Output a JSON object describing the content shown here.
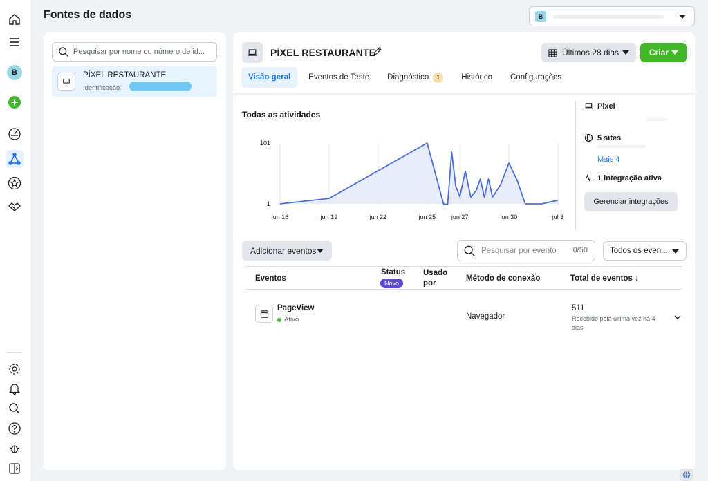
{
  "page": {
    "title": "Fontes de dados"
  },
  "account": {
    "badge": "B"
  },
  "left_rail": {
    "avatar": "B",
    "icons": [
      "home-icon",
      "menu-icon",
      "avatar",
      "add-icon",
      "dashboard-gauge-icon",
      "data-sources-icon",
      "star-icon",
      "partnerships-icon",
      "settings-icon",
      "bell-icon",
      "search-icon",
      "help-icon",
      "bug-icon",
      "panel-toggle-icon"
    ]
  },
  "sources": {
    "search_placeholder": "Pesquisar por nome ou número de id...",
    "items": [
      {
        "name": "PÍXEL RESTAURANTE",
        "id_label": "Identificação"
      }
    ]
  },
  "main": {
    "title": "PÍXEL RESTAURANTE",
    "date_range": "Últimos 28 dias",
    "create_label": "Criar",
    "tabs": [
      {
        "label": "Visão geral",
        "active": true
      },
      {
        "label": "Eventos de Teste"
      },
      {
        "label": "Diagnóstico",
        "badge": "1"
      },
      {
        "label": "Histórico"
      },
      {
        "label": "Configurações"
      }
    ]
  },
  "chart_data": {
    "type": "area",
    "title": "Todas as atividades",
    "x_tick_labels": [
      "jun 16",
      "jun 19",
      "jun 22",
      "jun 25",
      "jun 27",
      "jun 30",
      "jul 3"
    ],
    "y_tick_labels": [
      "1",
      "101"
    ],
    "ylim": [
      1,
      101
    ],
    "x": [
      "jun 16",
      "jun 19",
      "jun 25",
      "jun 26",
      "jun 26",
      "jun 26",
      "jun 26",
      "jun 27",
      "jun 27",
      "jun 27",
      "jun 28",
      "jun 28",
      "jun 28",
      "jun 28",
      "jun 29",
      "jun 29",
      "jun 30",
      "jun 30",
      "jul 1",
      "jul 2",
      "jul 3"
    ],
    "values": [
      1,
      10,
      101,
      1,
      0,
      86,
      30,
      13,
      55,
      12,
      23,
      42,
      12,
      42,
      12,
      33,
      68,
      40,
      1,
      1,
      7
    ],
    "grid": "vertical",
    "color": "#4a6fdc",
    "fill": "#e9ecf9"
  },
  "summary": {
    "pixel_label": "Pixel",
    "sites_label": "5 sites",
    "more_label": "Mais 4",
    "integration_label": "1 integração ativa",
    "manage_label": "Gerenciar integrações"
  },
  "events": {
    "add_label": "Adicionar eventos",
    "search_placeholder": "Pesquisar por evento",
    "count": "0/50",
    "filter_label": "Todos os even...",
    "headers": {
      "events": "Eventos",
      "status": "Status",
      "status_badge": "Novo",
      "used_by": "Usado por",
      "method": "Método de conexão",
      "total": "Total de eventos ↓"
    },
    "rows": [
      {
        "name": "PageView",
        "status": "Ativo",
        "method": "Navegador",
        "total": "511",
        "last_received": "Recebido pela última vez há 4 dias"
      }
    ]
  },
  "colors": {
    "accent": "#1877f2",
    "create": "#42b72a",
    "new_badge": "#5b49d6"
  }
}
